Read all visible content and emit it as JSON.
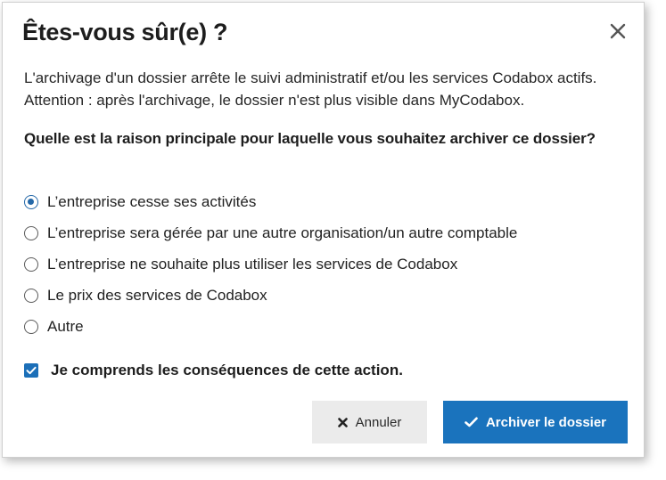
{
  "dialog": {
    "title": "Êtes-vous sûr(e) ?",
    "close_icon": "close-icon",
    "description": "L'archivage d'un dossier arrête le suivi administratif et/ou les services Codabox actifs. Attention : après l'archivage, le dossier n'est plus visible dans MyCodabox.",
    "question": "Quelle est la raison principale pour laquelle vous souhaitez archiver ce dossier?",
    "reasons": [
      {
        "label": "L’entreprise cesse ses activités",
        "selected": true
      },
      {
        "label": "L’entreprise sera gérée par une autre organisation/un autre comptable",
        "selected": false
      },
      {
        "label": "L’entreprise ne souhaite plus utiliser les services de Codabox",
        "selected": false
      },
      {
        "label": "Le prix des services de Codabox",
        "selected": false
      },
      {
        "label": "Autre",
        "selected": false
      }
    ],
    "confirm": {
      "label": "Je comprends les conséquences de cette action.",
      "checked": true
    },
    "buttons": {
      "cancel_label": "Annuler",
      "cancel_icon": "x-icon",
      "archive_label": "Archiver le dossier",
      "archive_icon": "check-icon"
    }
  },
  "colors": {
    "primary": "#1a73bd",
    "cancel_bg": "#ebebeb"
  }
}
